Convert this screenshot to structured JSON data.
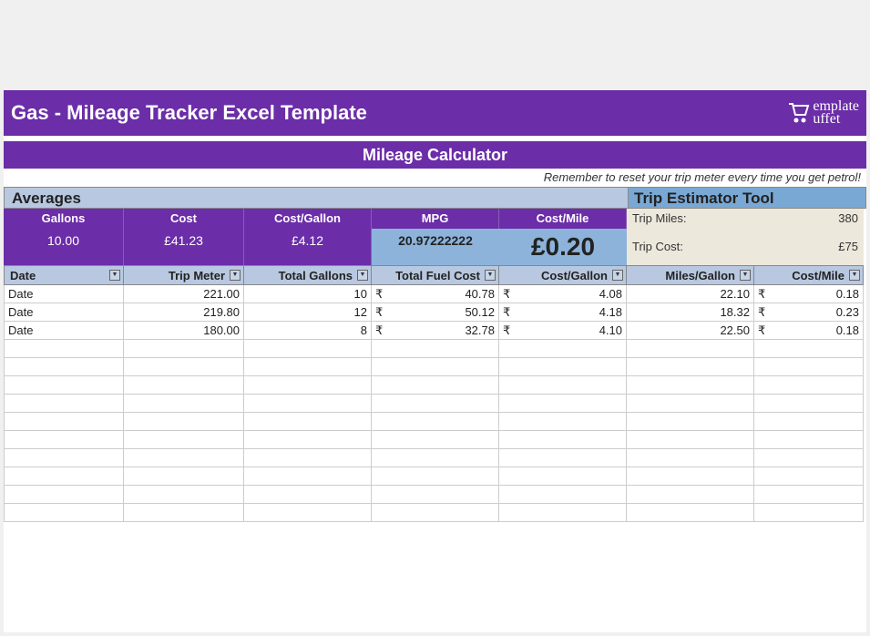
{
  "title": "Gas - Mileage Tracker Excel Template",
  "logo_text": "emplate",
  "logo_text2": "uffet",
  "calc_header": "Mileage Calculator",
  "reminder": "Remember to reset your trip meter every time you get petrol!",
  "averages_header": "Averages",
  "trip_header": "Trip Estimator Tool",
  "avg_labels": {
    "gallons": "Gallons",
    "cost": "Cost",
    "cost_gallon": "Cost/Gallon",
    "mpg": "MPG",
    "cost_mile": "Cost/Mile"
  },
  "avg_values": {
    "gallons": "10.00",
    "cost": "£41.23",
    "cost_gallon": "£4.12",
    "mpg": "20.97222222",
    "cost_mile": "£0.20"
  },
  "trip": {
    "miles_label": "Trip Miles:",
    "miles_value": "380",
    "cost_label": "Trip Cost:",
    "cost_value": "£75"
  },
  "columns": {
    "date": "Date",
    "trip_meter": "Trip Meter",
    "total_gallons": "Total Gallons",
    "total_fuel_cost": "Total Fuel Cost",
    "cost_gallon": "Cost/Gallon",
    "miles_gallon": "Miles/Gallon",
    "cost_mile": "Cost/Mile"
  },
  "currency": "₹",
  "rows": [
    {
      "date": "Date",
      "trip_meter": "221.00",
      "total_gallons": "10",
      "total_fuel_cost": "40.78",
      "cost_gallon": "4.08",
      "miles_gallon": "22.10",
      "cost_mile": "0.18"
    },
    {
      "date": "Date",
      "trip_meter": "219.80",
      "total_gallons": "12",
      "total_fuel_cost": "50.12",
      "cost_gallon": "4.18",
      "miles_gallon": "18.32",
      "cost_mile": "0.23"
    },
    {
      "date": "Date",
      "trip_meter": "180.00",
      "total_gallons": "8",
      "total_fuel_cost": "32.78",
      "cost_gallon": "4.10",
      "miles_gallon": "22.50",
      "cost_mile": "0.18"
    }
  ],
  "empty_rows": 10
}
